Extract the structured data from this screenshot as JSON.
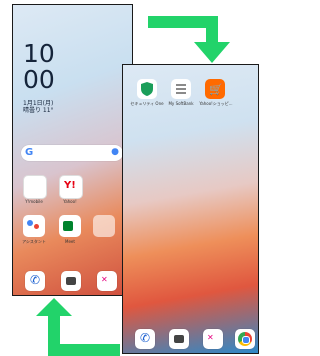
{
  "lock": {
    "time_hour": "10",
    "time_min": "00",
    "date_line": "1月1日(月)",
    "weather_line": "晴曇り 11°"
  },
  "home_back": {
    "search_logo": "G",
    "widget_labels": [
      "Y!mobile",
      "Yahoo!"
    ],
    "row3_labels": [
      "アシスタント",
      "Meet",
      ""
    ]
  },
  "home_front": {
    "apps": [
      {
        "label": "セキュリティ One",
        "icon": "security-shield-icon"
      },
      {
        "label": "My SoftBank",
        "icon": "softbank-icon"
      },
      {
        "label": "Yahoo!ショッピ...",
        "icon": "shopping-cart-icon"
      }
    ]
  },
  "colors": {
    "arrow": "#22d36a"
  }
}
